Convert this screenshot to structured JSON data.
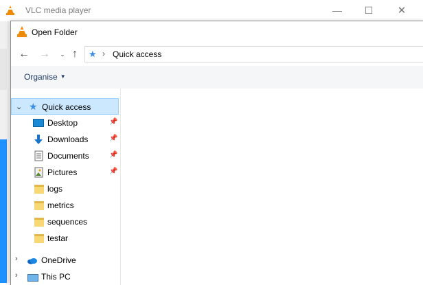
{
  "vlc": {
    "title": "VLC media player",
    "controls": {
      "minimize": "—",
      "maximize": "☐",
      "close": "✕"
    }
  },
  "dialog": {
    "title": "Open Folder",
    "nav": {
      "back": "←",
      "forward": "→",
      "recent": "⌄",
      "up": "↑"
    },
    "address": {
      "separator": "›",
      "location": "Quick access"
    },
    "toolbar": {
      "organise_label": "Organise"
    }
  },
  "nav_pane": {
    "items": [
      {
        "label": "Quick access",
        "icon": "quick-access-star-icon",
        "expanded": true,
        "selected": true
      },
      {
        "label": "Desktop",
        "icon": "desktop-icon",
        "pinned": true
      },
      {
        "label": "Downloads",
        "icon": "downloads-icon",
        "pinned": true
      },
      {
        "label": "Documents",
        "icon": "documents-icon",
        "pinned": true
      },
      {
        "label": "Pictures",
        "icon": "pictures-icon",
        "pinned": true
      },
      {
        "label": "logs",
        "icon": "folder-icon"
      },
      {
        "label": "metrics",
        "icon": "folder-icon"
      },
      {
        "label": "sequences",
        "icon": "folder-icon"
      },
      {
        "label": "testar",
        "icon": "folder-icon"
      },
      {
        "label": "OneDrive",
        "icon": "onedrive-icon",
        "expanded": false
      },
      {
        "label": "This PC",
        "icon": "this-pc-icon",
        "expanded": false
      }
    ]
  },
  "colors": {
    "selection": "#cce8ff",
    "selection_border": "#99d1ff",
    "folder": "#f8d775",
    "accent": "#1a8ad6"
  }
}
